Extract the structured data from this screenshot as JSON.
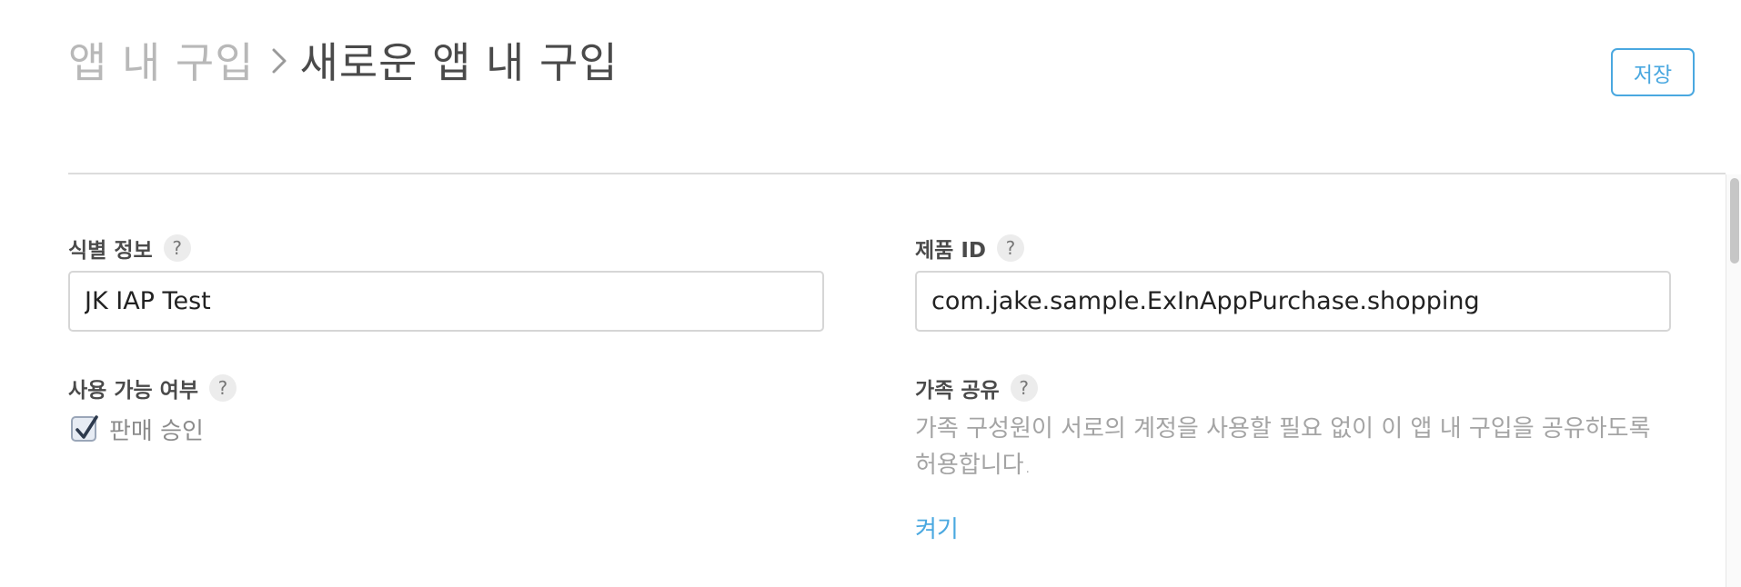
{
  "header": {
    "breadcrumb_parent": "앱 내 구입",
    "breadcrumb_current": "새로운 앱 내 구입",
    "save_label": "저장"
  },
  "form": {
    "reference_name": {
      "label": "식별 정보",
      "help": "?",
      "value": "JK IAP Test"
    },
    "product_id": {
      "label": "제품 ID",
      "help": "?",
      "value": "com.jake.sample.ExInAppPurchase.shopping"
    },
    "availability": {
      "label": "사용 가능 여부",
      "help": "?",
      "checkbox_label": "판매 승인",
      "checked": true
    },
    "family_sharing": {
      "label": "가족 공유",
      "help": "?",
      "description": "가족 구성원이 서로의 계정을 사용할 필요 없이 이 앱 내 구입을 공유하도록 허용합니다.",
      "action_label": "켜기"
    }
  },
  "colors": {
    "accent": "#4aa8e0",
    "divider": "#dcdcdc",
    "muted_text": "#a4a4a4"
  },
  "icons": {
    "breadcrumb_separator": "chevron-right-icon",
    "help": "question-mark-icon",
    "checkbox": "checkmark-icon"
  }
}
